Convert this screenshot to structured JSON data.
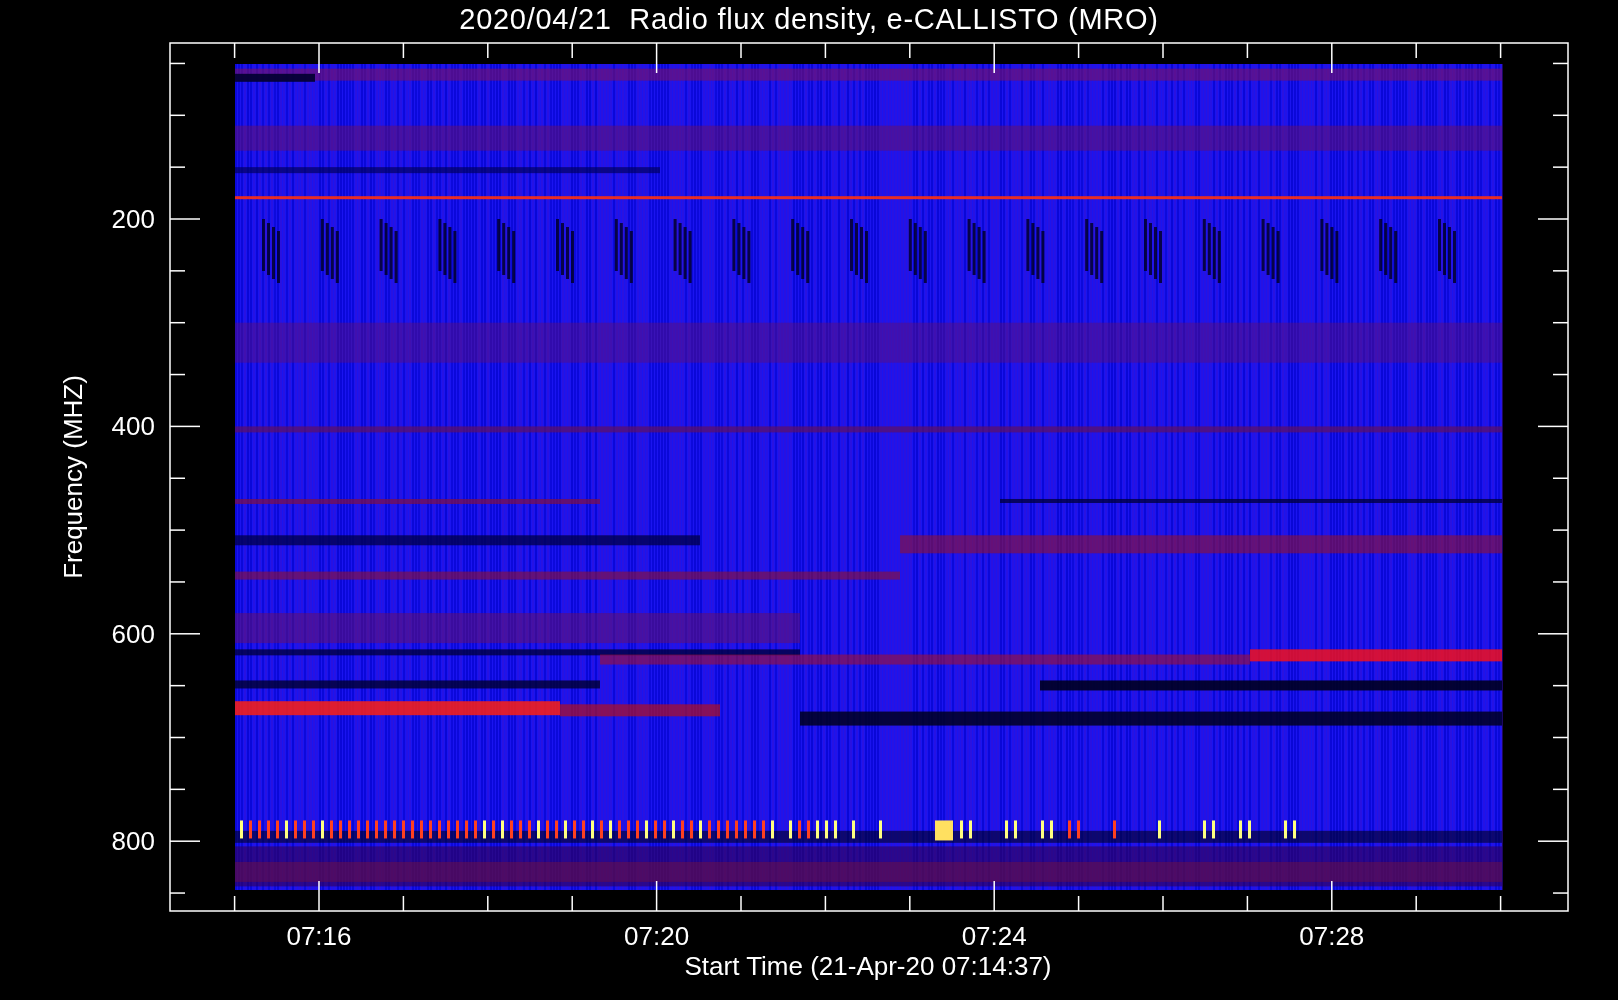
{
  "title": "2020/04/21  Radio flux density, e-CALLISTO (MRO)",
  "y_axis": {
    "label": "Frequency (MHZ)",
    "ticks": [
      "200",
      "400",
      "600",
      "800"
    ]
  },
  "x_axis": {
    "label": "Start Time (21-Apr-20 07:14:37)",
    "ticks": [
      "07:16",
      "07:20",
      "07:24",
      "07:28"
    ]
  }
}
